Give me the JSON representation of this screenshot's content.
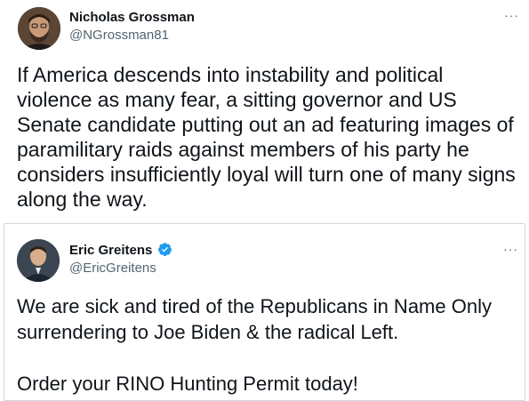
{
  "outer_tweet": {
    "author_name": "Nicholas Grossman",
    "author_handle": "@NGrossman81",
    "more_label": "···",
    "text": "If America descends into instability and political violence as many fear, a sitting governor and US Senate candidate putting out an ad featuring images of paramilitary raids against members of his party he considers insufficiently loyal will turn one of many signs along the way."
  },
  "quoted_tweet": {
    "author_name": "Eric Greitens",
    "author_handle": "@EricGreitens",
    "verified": true,
    "more_label": "···",
    "line1": "We are sick and tired of the Republicans in Name Only",
    "line2": "surrendering to Joe Biden & the radical Left.",
    "line3": "Order your RINO Hunting Permit today!"
  },
  "colors": {
    "text_primary": "#0f1419",
    "text_secondary": "#536471",
    "verified_blue": "#1d9bf0",
    "border": "#cfd9de"
  },
  "icons": {
    "verified": "verified-badge-icon",
    "more": "more-options-icon"
  }
}
